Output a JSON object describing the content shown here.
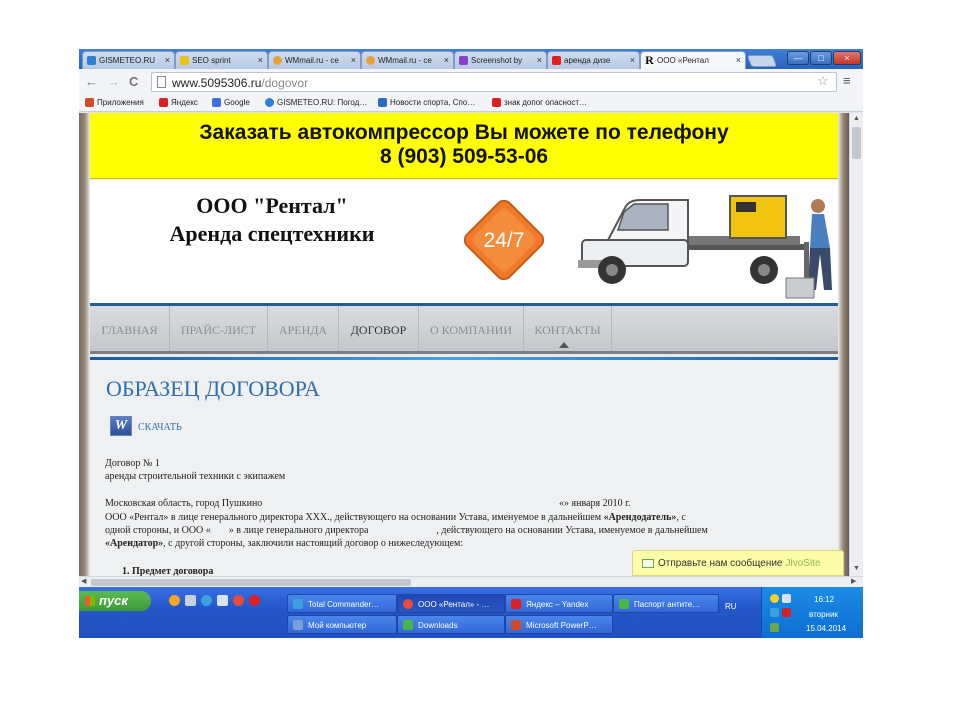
{
  "browser": {
    "tabs": [
      {
        "label": "GISMETEO.RU",
        "color": "#2c7fd6"
      },
      {
        "label": "SEO sprint",
        "color": "#e9c21a"
      },
      {
        "label": "WMmail.ru - сe",
        "color": "#e7a23b"
      },
      {
        "label": "WMmail.ru - сe",
        "color": "#e7a23b"
      },
      {
        "label": "Screenshot by",
        "color": "#8a3fc7"
      },
      {
        "label": "аренда дизе",
        "color": "#e02020"
      },
      {
        "label": "ООО «Рентал",
        "color": "#111111",
        "glyph": "R"
      }
    ],
    "close_glyph": "×",
    "window_buttons": {
      "minimize": "—",
      "maximize": "□",
      "close": "×"
    },
    "address": {
      "domain": "www.5095306.ru",
      "path": "/dogovor"
    },
    "bookmarks": [
      {
        "label": "Приложения",
        "color": "#d24b24"
      },
      {
        "label": "Яндекс",
        "color": "#e02020"
      },
      {
        "label": "Google",
        "color": "#3c6fe0"
      },
      {
        "label": "GISMETEO.RU: Погод…",
        "color": "#2c7fd6"
      },
      {
        "label": "Новости спорта, Спо…",
        "color": "#2a6cc4"
      },
      {
        "label": "знак допог опасност…",
        "color": "#e02020"
      }
    ]
  },
  "site": {
    "banner_line1": "Заказать автокомпрессор Вы можете по телефону",
    "banner_line2": "8 (903) 509-53-06",
    "company_name": "ООО \"Рентал\"",
    "company_tagline": "Аренда спецтехники",
    "badge_text": "24/7",
    "nav": [
      "ГЛАВНАЯ",
      "ПРАЙС-ЛИСТ",
      "АРЕНДА",
      "ДОГОВОР",
      "О КОМПАНИИ",
      "КОНТАКТЫ"
    ],
    "nav_active": "ДОГОВОР",
    "page_title": "ОБРАЗЕЦ ДОГОВОРА",
    "download_label": "СКАЧАТЬ",
    "doc": {
      "line1": "Договор № 1",
      "line2": "аренды строительной техники с экипажем",
      "place": "Московская область, город Пушкино",
      "date": "«» января 2010 г.",
      "p1a": "ООО «Рентал» в лице генерального директора XXX., действующего на основании Устава, именуемое в дальнейшем ",
      "p1b": "«Арендодатель»",
      "p1c": ", с",
      "p2a": "одной стороны, и ООО «",
      "p2b": "» в лице генерального директора",
      "p2c": ", действующего на основании Устава, именуемое в дальнейшем",
      "p3a": "«Арендатор»",
      "p3b": ", с другой стороны, заключили настоящий договор о нижеследующем:",
      "section1": "1. Предмет договора"
    },
    "jivo_message": "Отправьте нам сообщение",
    "jivo_brand": "JivoSite"
  },
  "taskbar": {
    "start_label": "пуск",
    "tasks_top": [
      {
        "label": "Total Commander…",
        "color": "#3aa0e0"
      },
      {
        "label": "ООО «Рентал» - …",
        "color": "#e94c3d"
      },
      {
        "label": "Яндекс – Yandex",
        "color": "#e02020"
      },
      {
        "label": "Паспорт антите…",
        "color": "#47b847"
      }
    ],
    "tasks_bottom": [
      {
        "label": "Мой компьютер",
        "color": "#7a9fd6"
      },
      {
        "label": "Downloads",
        "color": "#47b847"
      },
      {
        "label": "Microsoft PowerP…",
        "color": "#d24b24"
      }
    ],
    "language": "RU",
    "clock_time": "16:12",
    "clock_day": "вторник",
    "clock_date": "15.04.2014"
  }
}
